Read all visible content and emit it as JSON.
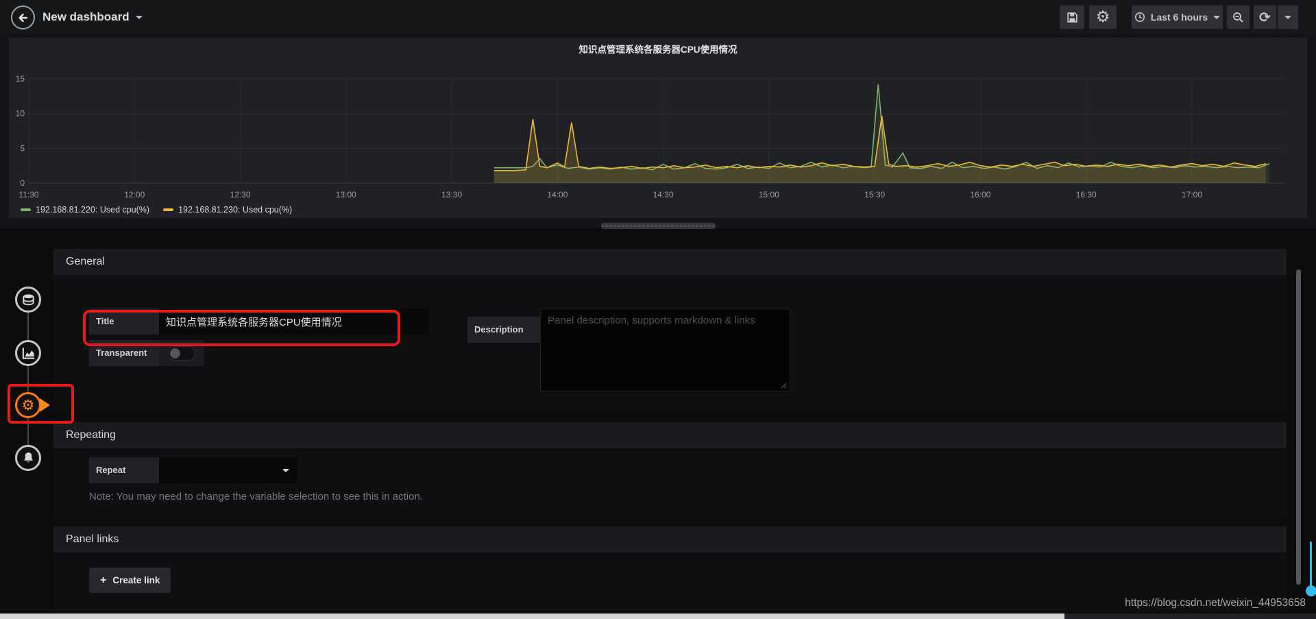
{
  "navbar": {
    "title": "New dashboard",
    "time_label": "Last 6 hours"
  },
  "icons": {
    "gear": "⚙",
    "refresh": "⟳",
    "plus": "+"
  },
  "tabs": [
    {
      "name": "queries",
      "active": false
    },
    {
      "name": "visualization",
      "active": false
    },
    {
      "name": "general",
      "active": true
    },
    {
      "name": "alert",
      "active": false
    }
  ],
  "sections": {
    "general": {
      "heading": "General",
      "title_label": "Title",
      "title_value": "知识点管理系统各服务器CPU使用情况",
      "transparent_label": "Transparent",
      "transparent_enabled": false,
      "description_label": "Description",
      "description_placeholder": "Panel description, supports markdown & links",
      "description_value": ""
    },
    "repeating": {
      "heading": "Repeating",
      "repeat_label": "Repeat",
      "repeat_value": "",
      "note": "Note: You may need to change the variable selection to see this in action."
    },
    "panel_links": {
      "heading": "Panel links",
      "create_link_label": "Create link"
    }
  },
  "watermark": "https://blog.csdn.net/weixin_44953658",
  "chart_data": {
    "type": "line",
    "title": "知识点管理系统各服务器CPU使用情况",
    "xlabel": "",
    "ylabel": "",
    "ylim": [
      0,
      15
    ],
    "yticks": [
      0,
      5,
      10,
      15
    ],
    "grid": true,
    "legend_position": "bottom-left",
    "x_tick_labels": [
      "11:30",
      "12:00",
      "12:30",
      "13:00",
      "13:30",
      "14:00",
      "14:30",
      "15:00",
      "15:30",
      "16:00",
      "16:30",
      "17:00"
    ],
    "x_tick_minutes": [
      0,
      30,
      60,
      90,
      120,
      150,
      180,
      210,
      240,
      270,
      300,
      330
    ],
    "x_range_minutes": [
      0,
      356
    ],
    "data_start_label": "13:42",
    "series": [
      {
        "name": "192.168.81.220: Used cpu(%)",
        "color": "#7eb26d",
        "fill_opacity": 0.1,
        "points": [
          [
            132,
            2.2
          ],
          [
            135,
            2.2
          ],
          [
            138,
            2.2
          ],
          [
            141,
            2.2
          ],
          [
            143,
            2.4
          ],
          [
            145,
            3.5
          ],
          [
            147,
            2.2
          ],
          [
            150,
            2.6
          ],
          [
            153,
            2.1
          ],
          [
            156,
            2.3
          ],
          [
            159,
            2.0
          ],
          [
            162,
            2.2
          ],
          [
            165,
            2.0
          ],
          [
            168,
            2.3
          ],
          [
            171,
            2.0
          ],
          [
            174,
            2.2
          ],
          [
            177,
            1.9
          ],
          [
            180,
            2.7
          ],
          [
            183,
            2.0
          ],
          [
            186,
            2.2
          ],
          [
            189,
            2.8
          ],
          [
            192,
            2.1
          ],
          [
            195,
            2.0
          ],
          [
            198,
            2.2
          ],
          [
            201,
            2.7
          ],
          [
            204,
            2.1
          ],
          [
            207,
            2.3
          ],
          [
            210,
            2.1
          ],
          [
            213,
            2.9
          ],
          [
            216,
            2.2
          ],
          [
            219,
            2.4
          ],
          [
            222,
            3.0
          ],
          [
            225,
            2.3
          ],
          [
            228,
            2.6
          ],
          [
            231,
            2.2
          ],
          [
            234,
            2.4
          ],
          [
            237,
            2.2
          ],
          [
            239,
            2.3
          ],
          [
            241,
            14.2
          ],
          [
            243,
            2.6
          ],
          [
            245,
            2.3
          ],
          [
            248,
            4.3
          ],
          [
            250,
            2.2
          ],
          [
            253,
            2.1
          ],
          [
            256,
            2.4
          ],
          [
            259,
            2.1
          ],
          [
            262,
            3.0
          ],
          [
            265,
            2.2
          ],
          [
            268,
            2.4
          ],
          [
            271,
            2.1
          ],
          [
            274,
            2.3
          ],
          [
            277,
            2.0
          ],
          [
            280,
            2.4
          ],
          [
            283,
            3.0
          ],
          [
            286,
            2.1
          ],
          [
            289,
            2.5
          ],
          [
            292,
            2.2
          ],
          [
            295,
            2.9
          ],
          [
            298,
            2.3
          ],
          [
            301,
            2.5
          ],
          [
            304,
            2.3
          ],
          [
            307,
            3.0
          ],
          [
            310,
            2.4
          ],
          [
            313,
            2.2
          ],
          [
            316,
            2.5
          ],
          [
            319,
            2.2
          ],
          [
            322,
            2.4
          ],
          [
            325,
            2.2
          ],
          [
            328,
            2.5
          ],
          [
            331,
            2.3
          ],
          [
            334,
            2.4
          ],
          [
            337,
            2.2
          ],
          [
            340,
            2.4
          ],
          [
            343,
            2.2
          ],
          [
            346,
            2.3
          ],
          [
            349,
            2.2
          ],
          [
            352,
            2.8
          ]
        ]
      },
      {
        "name": "192.168.81.230: Used cpu(%)",
        "color": "#eab839",
        "fill_opacity": 0.18,
        "points": [
          [
            132,
            1.8
          ],
          [
            135,
            1.8
          ],
          [
            138,
            1.8
          ],
          [
            141,
            1.9
          ],
          [
            143,
            9.2
          ],
          [
            145,
            2.4
          ],
          [
            147,
            2.2
          ],
          [
            150,
            2.9
          ],
          [
            152,
            2.3
          ],
          [
            154,
            8.7
          ],
          [
            156,
            2.4
          ],
          [
            159,
            2.1
          ],
          [
            162,
            2.3
          ],
          [
            165,
            2.1
          ],
          [
            168,
            2.2
          ],
          [
            171,
            2.4
          ],
          [
            174,
            2.1
          ],
          [
            177,
            2.3
          ],
          [
            180,
            2.2
          ],
          [
            183,
            2.5
          ],
          [
            186,
            2.2
          ],
          [
            189,
            2.3
          ],
          [
            192,
            2.6
          ],
          [
            195,
            2.2
          ],
          [
            198,
            2.4
          ],
          [
            201,
            2.2
          ],
          [
            204,
            2.5
          ],
          [
            207,
            2.2
          ],
          [
            210,
            2.4
          ],
          [
            213,
            2.3
          ],
          [
            216,
            2.6
          ],
          [
            219,
            2.3
          ],
          [
            222,
            2.5
          ],
          [
            225,
            2.9
          ],
          [
            228,
            2.5
          ],
          [
            231,
            2.7
          ],
          [
            234,
            2.4
          ],
          [
            237,
            2.3
          ],
          [
            240,
            2.4
          ],
          [
            242,
            9.7
          ],
          [
            244,
            2.7
          ],
          [
            246,
            2.4
          ],
          [
            249,
            2.5
          ],
          [
            252,
            2.3
          ],
          [
            255,
            2.5
          ],
          [
            258,
            2.8
          ],
          [
            261,
            2.4
          ],
          [
            264,
            2.6
          ],
          [
            267,
            3.0
          ],
          [
            270,
            2.5
          ],
          [
            273,
            2.3
          ],
          [
            276,
            2.6
          ],
          [
            279,
            2.4
          ],
          [
            282,
            2.7
          ],
          [
            285,
            2.4
          ],
          [
            288,
            2.7
          ],
          [
            291,
            3.0
          ],
          [
            294,
            2.5
          ],
          [
            297,
            2.7
          ],
          [
            300,
            2.4
          ],
          [
            303,
            2.6
          ],
          [
            306,
            2.4
          ],
          [
            309,
            2.7
          ],
          [
            312,
            2.5
          ],
          [
            315,
            2.7
          ],
          [
            318,
            2.4
          ],
          [
            321,
            2.6
          ],
          [
            324,
            2.3
          ],
          [
            327,
            2.6
          ],
          [
            330,
            2.8
          ],
          [
            333,
            2.5
          ],
          [
            336,
            2.7
          ],
          [
            339,
            2.4
          ],
          [
            342,
            2.9
          ],
          [
            345,
            2.6
          ],
          [
            348,
            2.4
          ],
          [
            351,
            2.8
          ]
        ]
      }
    ]
  }
}
